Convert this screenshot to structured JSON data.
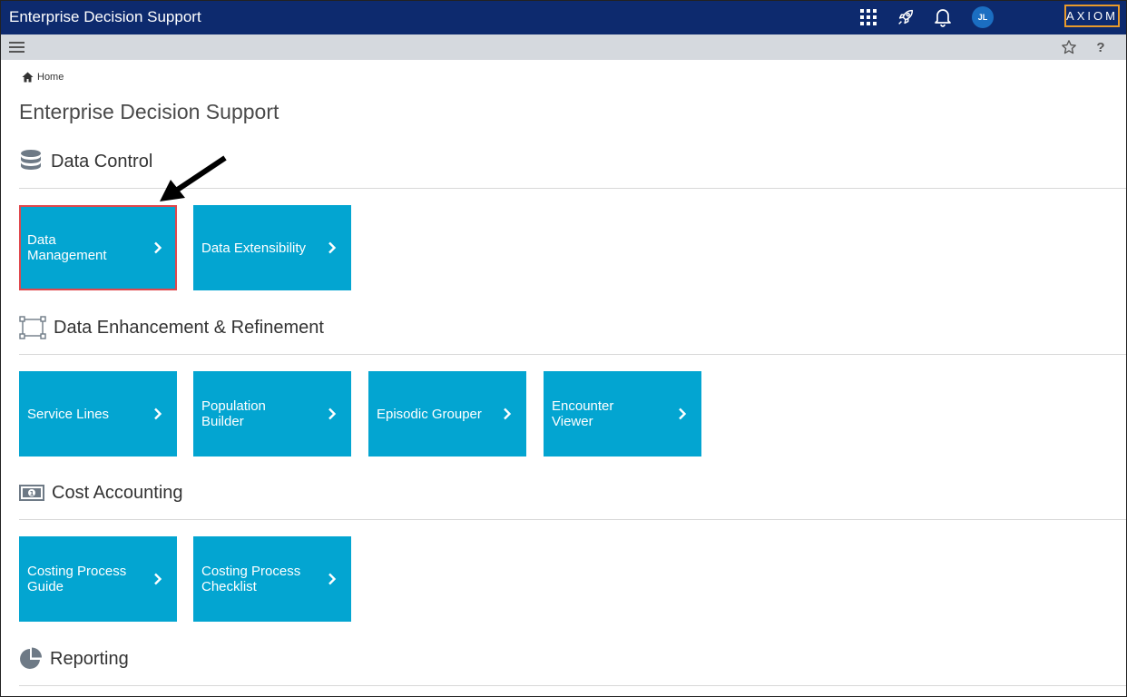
{
  "app": {
    "title": "Enterprise Decision Support",
    "user_initials": "JL",
    "logo_text": "AXIOM"
  },
  "toolbar": {
    "icons": [
      "apps-grid-icon",
      "rocket-icon",
      "bell-icon",
      "star-icon",
      "help-icon",
      "hamburger-menu-icon"
    ],
    "help_label": "?"
  },
  "breadcrumb": {
    "home_label": "Home"
  },
  "page": {
    "title": "Enterprise Decision Support"
  },
  "sections": {
    "data_control": {
      "title": "Data Control",
      "tiles": [
        "Data\nManagement",
        "Data Extensibility"
      ]
    },
    "data_enhancement": {
      "title": "Data Enhancement & Refinement",
      "tiles": [
        "Service Lines",
        "Population\nBuilder",
        "Episodic Grouper",
        "Encounter\nViewer"
      ]
    },
    "cost_accounting": {
      "title": "Cost Accounting",
      "tiles": [
        "Costing Process\nGuide",
        "Costing Process\nChecklist"
      ]
    },
    "reporting": {
      "title": "Reporting"
    }
  },
  "colors": {
    "topbar": "#0d2a6e",
    "subbar": "#d5d9de",
    "tile": "#03a5d1",
    "highlight": "#e0474c",
    "logo_border": "#e89a2b"
  }
}
